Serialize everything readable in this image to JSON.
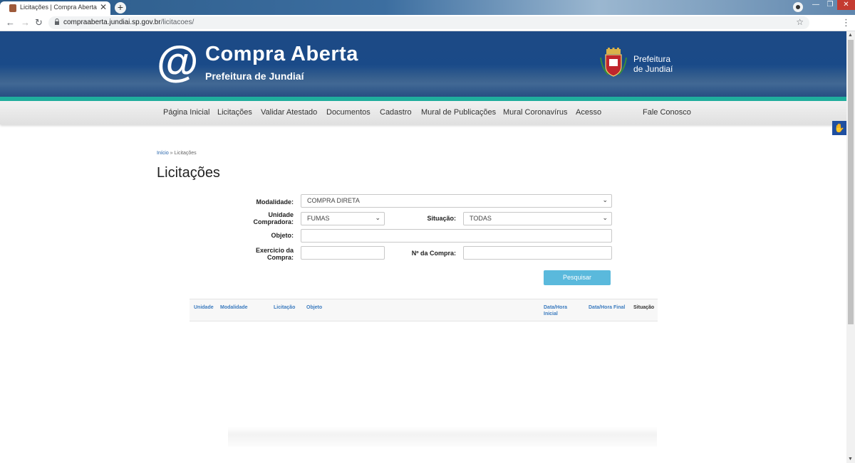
{
  "browser": {
    "tab_title": "Licitações | Compra Aberta",
    "tab_close": "✕",
    "new_tab": "+",
    "url_host": "compraaberta.jundiai.sp.gov.br",
    "url_path": "/licitacoes/",
    "back": "←",
    "forward": "→",
    "reload": "↻",
    "star": "☆",
    "menu": "⋮",
    "lock": "🔒",
    "win_min": "—",
    "win_max": "❐",
    "win_close": "✕"
  },
  "header": {
    "logo_symbol": "@",
    "logo_title": "Compra Aberta",
    "logo_subtitle": "Prefeitura de Jundiaí",
    "pref_line1": "Prefeitura",
    "pref_line2": "de Jundiaí"
  },
  "nav": {
    "items": [
      "Página Inicial",
      "Licitações",
      "Validar Atestado",
      "Documentos",
      "Cadastro",
      "Mural de Publicações",
      "Mural Coronavírus",
      "Acesso",
      "Fale Conosco"
    ]
  },
  "breadcrumb": {
    "home": "Início",
    "sep": " » ",
    "current": "Licitações"
  },
  "page": {
    "title": "Licitações"
  },
  "form": {
    "modalidade_label": "Modalidade:",
    "modalidade_value": "COMPRA DIRETA",
    "unidade_label_1": "Unidade",
    "unidade_label_2": "Compradora:",
    "unidade_value": "FUMAS",
    "situacao_label": "Situação:",
    "situacao_value": "TODAS",
    "objeto_label": "Objeto:",
    "objeto_value": "",
    "exercicio_label_1": "Exercicio da",
    "exercicio_label_2": "Compra:",
    "exercicio_value": "",
    "ncompra_label": "Nº da Compra:",
    "ncompra_value": "",
    "search_button": "Pesquisar",
    "chevron": "⌄"
  },
  "table": {
    "headers": {
      "unidade": "Unidade",
      "modalidade": "Modalidade",
      "licitacao": "Licitação",
      "objeto": "Objeto",
      "data_inicial_1": "Data/Hora",
      "data_inicial_2": "Inicial",
      "data_final": "Data/Hora Final",
      "situacao": "Situação"
    }
  },
  "accessibility": {
    "icon": "✋"
  },
  "colors": {
    "header_blue": "#1d4a85",
    "teal": "#1fae9d",
    "button": "#5ab9dc",
    "link": "#3b7bbf"
  }
}
